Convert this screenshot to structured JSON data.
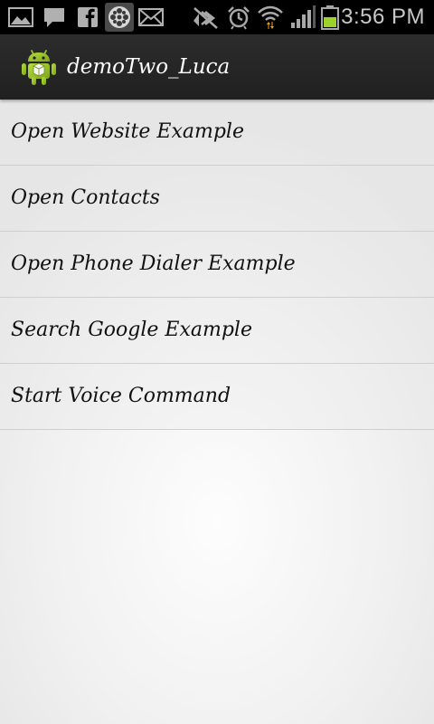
{
  "status_bar": {
    "time": "3:56 PM",
    "icons": [
      "gallery-icon",
      "message-icon",
      "facebook-icon",
      "film-reel-icon",
      "email-icon",
      "mute-icon",
      "alarm-icon",
      "wifi-icon",
      "signal-icon",
      "battery-icon"
    ]
  },
  "action_bar": {
    "title": "demoTwo_Luca",
    "icon": "android-icon"
  },
  "menu": {
    "items": [
      {
        "label": "Open Website Example"
      },
      {
        "label": "Open Contacts"
      },
      {
        "label": "Open Phone Dialer Example"
      },
      {
        "label": "Search Google Example"
      },
      {
        "label": "Start Voice Command"
      }
    ]
  },
  "colors": {
    "status_bar_bg": "#000000",
    "action_bar_bg": "#262626",
    "android_green": "#97c024",
    "battery_green": "#9dd22a",
    "wifi_arrow_orange": "#f0a020",
    "list_text": "#111111",
    "divider": "#cfcfcf"
  }
}
